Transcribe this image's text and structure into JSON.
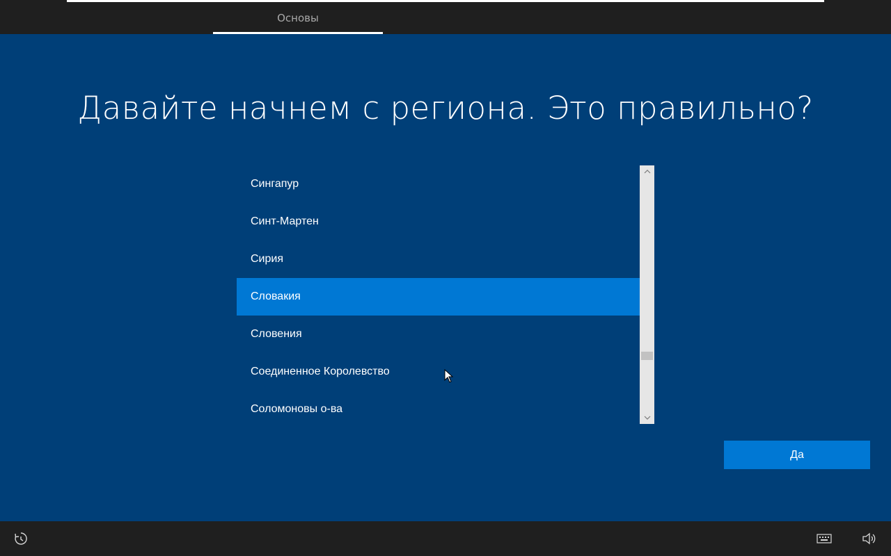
{
  "header": {
    "tab_label": "Основы"
  },
  "main": {
    "title": "Давайте начнем с региона. Это правильно?",
    "regions": [
      {
        "label": "Сингапур",
        "selected": false
      },
      {
        "label": "Синт-Мартен",
        "selected": false
      },
      {
        "label": "Сирия",
        "selected": false
      },
      {
        "label": "Словакия",
        "selected": true
      },
      {
        "label": "Словения",
        "selected": false
      },
      {
        "label": "Соединенное Королевство",
        "selected": false
      },
      {
        "label": "Соломоновы о-ва",
        "selected": false
      }
    ],
    "confirm_button_label": "Да"
  },
  "footer": {
    "left_icon": "ease-of-access-icon",
    "right_icons": [
      "keyboard-icon",
      "volume-icon"
    ]
  },
  "colors": {
    "background_blue": "#003f78",
    "accent": "#0078d4",
    "bar": "#1f1f1f"
  }
}
